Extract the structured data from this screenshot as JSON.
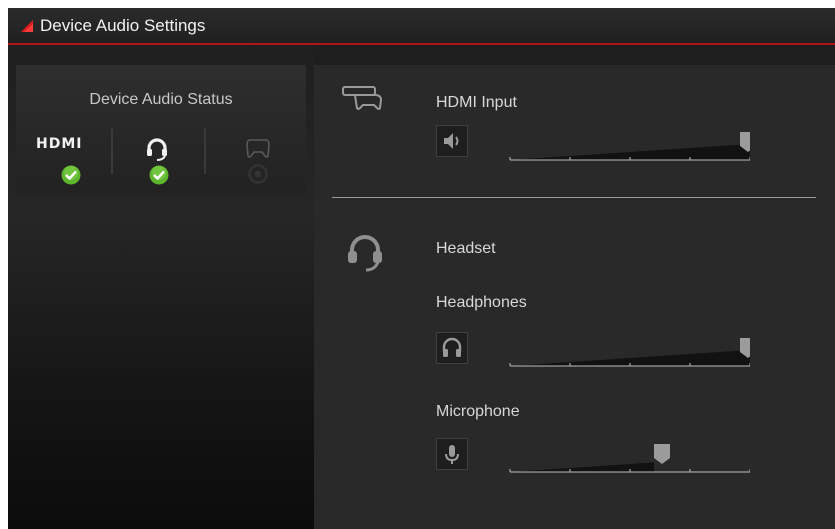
{
  "window": {
    "title": "Device Audio Settings"
  },
  "status": {
    "title": "Device Audio Status",
    "hdmi_label": "HDMI",
    "devices": [
      {
        "name": "hdmi-icon",
        "connected": true
      },
      {
        "name": "headset-icon",
        "connected": true
      },
      {
        "name": "controller-icon",
        "connected": false
      }
    ]
  },
  "sections": {
    "hdmi": {
      "label": "HDMI Input",
      "volume": 1.0
    },
    "headset": {
      "label": "Headset",
      "headphones": {
        "label": "Headphones",
        "volume": 1.0
      },
      "microphone": {
        "label": "Microphone",
        "volume": 0.6
      }
    }
  },
  "colors": {
    "accent": "#b3121b",
    "check": "#5fb52d",
    "thumb": "#9b9b9b"
  }
}
